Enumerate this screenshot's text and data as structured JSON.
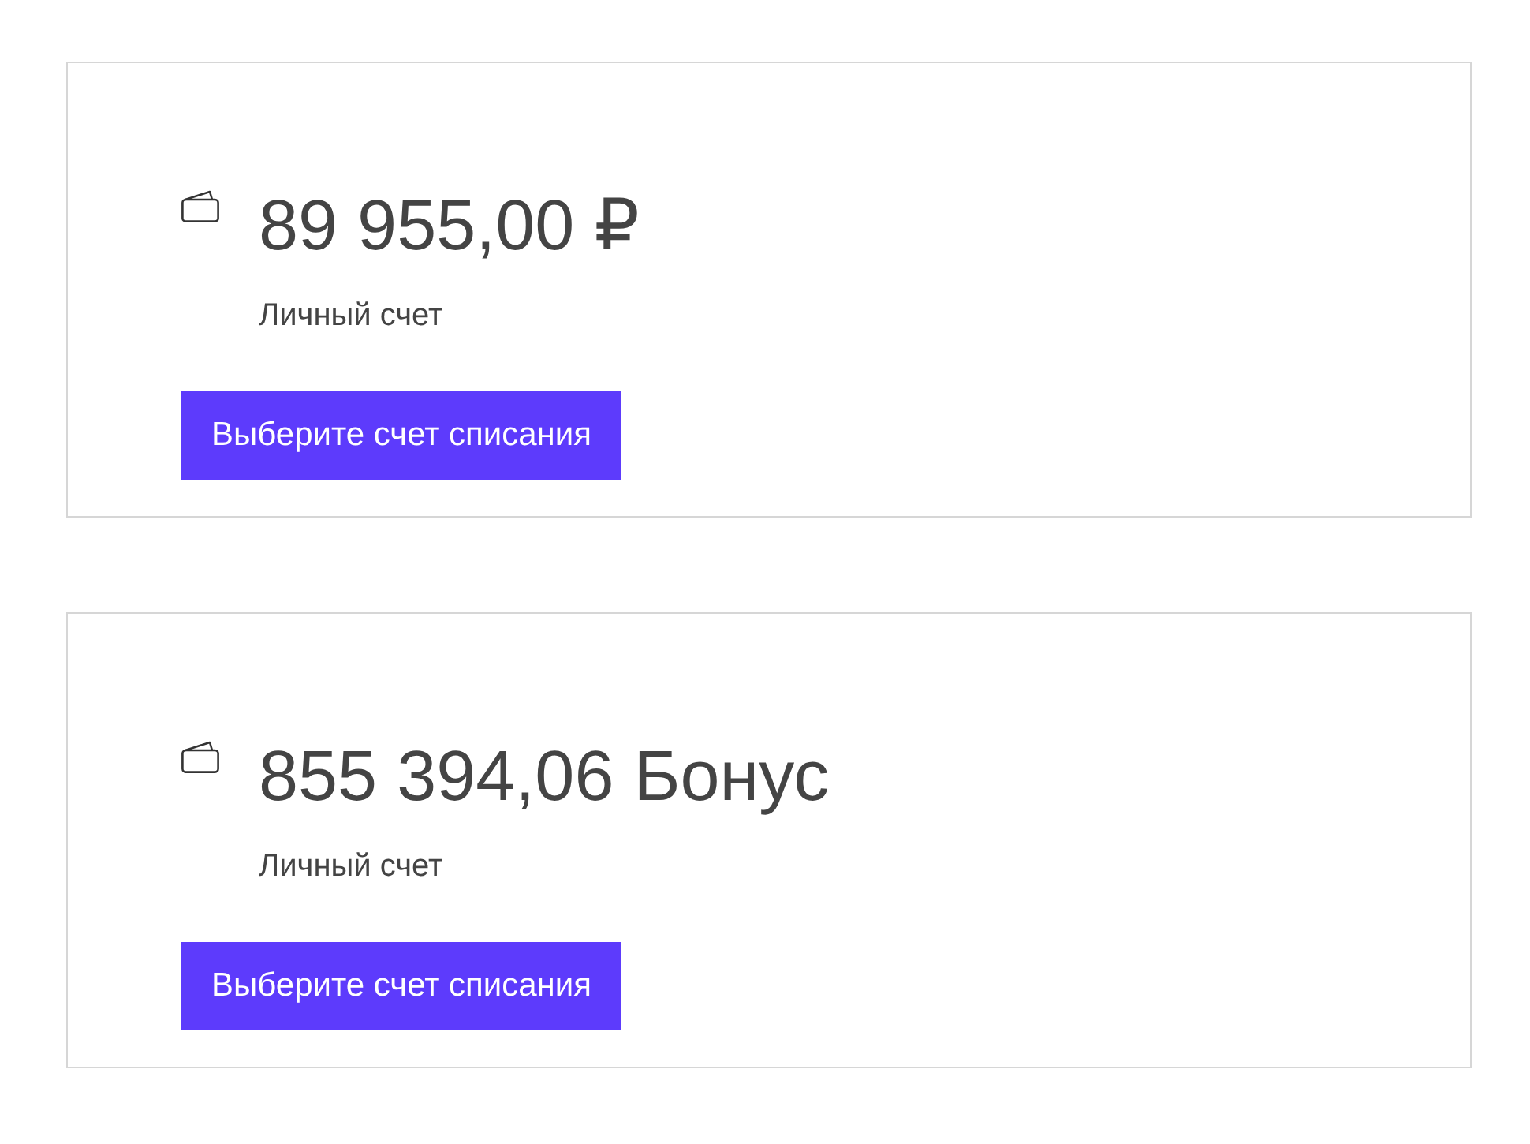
{
  "accounts": [
    {
      "amount": "89 955,00 ₽",
      "label": "Личный счет",
      "button": "Выберите счет списания"
    },
    {
      "amount": "855 394,06 Бонус",
      "label": "Личный счет",
      "button": "Выберите счет списания"
    }
  ]
}
